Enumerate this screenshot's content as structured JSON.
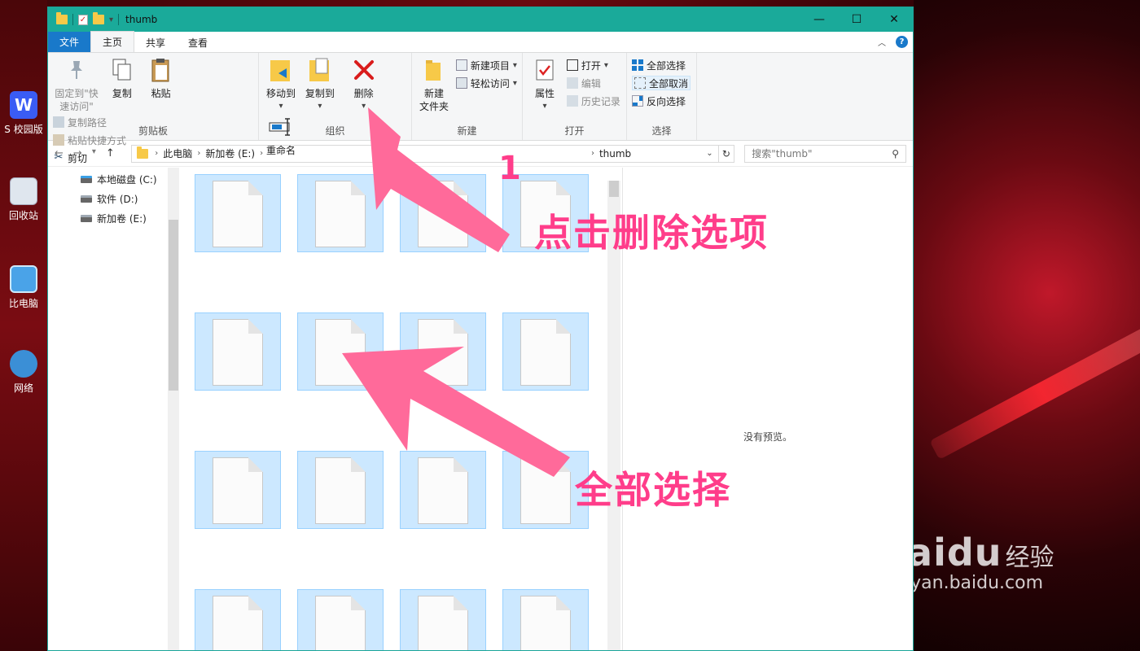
{
  "desktop": {
    "icons": [
      {
        "label": "S 校园版",
        "icon": "wps-icon"
      },
      {
        "label": "回收站",
        "icon": "recycle-bin-icon"
      },
      {
        "label": "比电脑",
        "icon": "computer-icon"
      },
      {
        "label": "网络",
        "icon": "network-icon"
      }
    ],
    "watermark": {
      "brand": "Bai",
      "brand2": "du",
      "sub": "经验",
      "url": "jingyan.baidu.com"
    }
  },
  "window": {
    "title": "thumb",
    "controls": {
      "minimize": "—",
      "maximize": "☐",
      "close": "✕"
    }
  },
  "tabs": [
    {
      "label": "文件",
      "kind": "file"
    },
    {
      "label": "主页",
      "kind": "active"
    },
    {
      "label": "共享",
      "kind": "normal"
    },
    {
      "label": "查看",
      "kind": "normal"
    }
  ],
  "ribbon": {
    "clipboard": {
      "label": "剪贴板",
      "pin": "固定到\"快速访问\"",
      "copy": "复制",
      "paste": "粘贴",
      "copy_path": "复制路径",
      "paste_shortcut": "粘贴快捷方式",
      "cut": "剪切"
    },
    "organize": {
      "label": "组织",
      "move_to": "移动到",
      "copy_to": "复制到",
      "delete": "删除",
      "rename": "重命名"
    },
    "new": {
      "label": "新建",
      "new_folder": "新建\n文件夹",
      "new_item": "新建项目",
      "easy_access": "轻松访问"
    },
    "open": {
      "label": "打开",
      "properties": "属性",
      "open": "打开",
      "edit": "编辑",
      "history": "历史记录"
    },
    "select": {
      "label": "选择",
      "select_all": "全部选择",
      "select_none": "全部取消",
      "invert": "反向选择"
    }
  },
  "address": {
    "crumbs": [
      "此电脑",
      "新加卷 (E:)"
    ],
    "current": "thumb",
    "search_placeholder": "搜索\"thumb\""
  },
  "nav_pane": {
    "items": [
      "本地磁盘 (C:)",
      "软件 (D:)",
      "新加卷 (E:)"
    ]
  },
  "preview": {
    "message": "没有预览。"
  },
  "annotations": {
    "step_number": "1",
    "delete_hint": "点击删除选项",
    "select_hint": "全部选择",
    "color": "#ff3d8a"
  },
  "colors": {
    "titlebar": "#1aaa9a",
    "file_tab": "#1979ca",
    "selection": "#cce8ff"
  }
}
